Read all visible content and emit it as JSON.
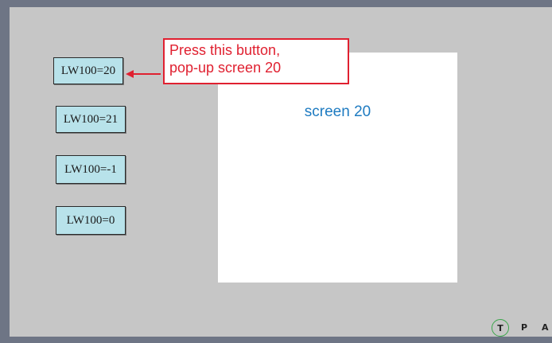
{
  "buttons": [
    {
      "label": "LW100=20"
    },
    {
      "label": "LW100=21"
    },
    {
      "label": "LW100=-1"
    },
    {
      "label": "LW100=0"
    }
  ],
  "callout": {
    "line1": "Press this button,",
    "line2": "pop-up screen 20"
  },
  "popup": {
    "title": "screen 20"
  },
  "mode_bar": {
    "t": "T",
    "p": "P",
    "a": "A"
  },
  "colors": {
    "button_fill": "#b8e2ea",
    "callout_red": "#e02030",
    "popup_title_blue": "#1e7bc1",
    "panel_gray": "#c6c6c6"
  }
}
